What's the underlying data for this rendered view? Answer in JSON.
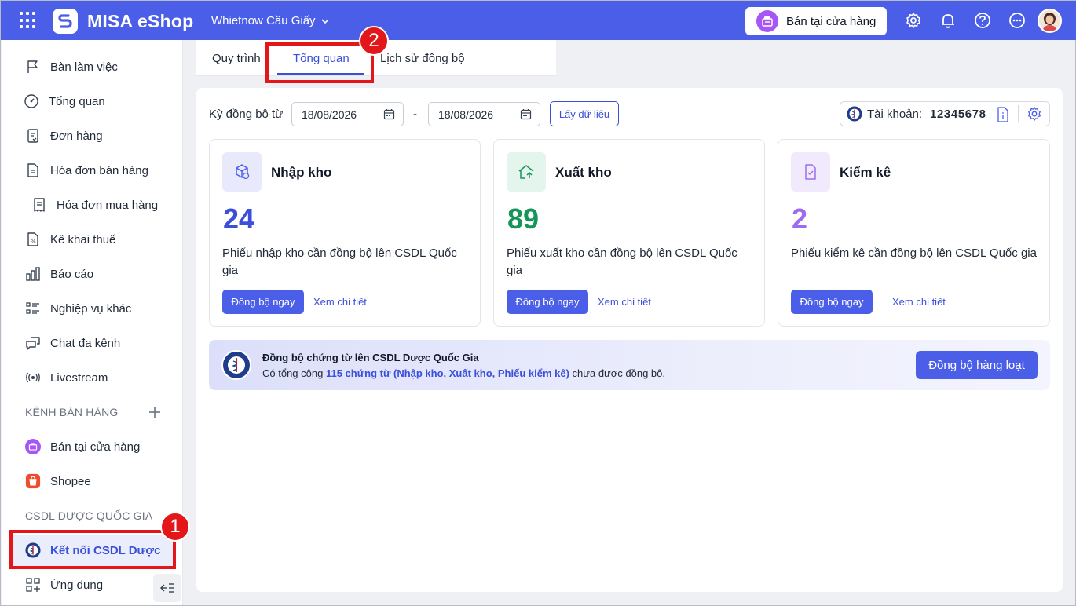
{
  "header": {
    "app_title": "MISA eShop",
    "store_name": "Whietnow Cầu Giấy",
    "sell_button": "Bán tại cửa hàng",
    "brand_color": "#4b5ee8"
  },
  "sidebar": {
    "items": [
      {
        "label": "Bàn làm việc",
        "icon": "flag-icon"
      },
      {
        "label": "Tổng quan",
        "icon": "dashboard-icon"
      },
      {
        "label": "Đơn hàng",
        "icon": "order-icon"
      },
      {
        "label": "Hóa đơn bán hàng",
        "icon": "invoice-icon"
      },
      {
        "label": "Hóa đơn mua hàng",
        "icon": "receipt-icon"
      },
      {
        "label": "Kê khai thuế",
        "icon": "tax-icon"
      },
      {
        "label": "Báo cáo",
        "icon": "chart-icon"
      },
      {
        "label": "Nghiệp vụ khác",
        "icon": "list-icon"
      },
      {
        "label": "Chat đa kênh",
        "icon": "chat-icon"
      },
      {
        "label": "Livestream",
        "icon": "broadcast-icon"
      }
    ],
    "section_sales": "KÊNH BÁN HÀNG",
    "sales_items": [
      {
        "label": "Bán tại cửa hàng"
      },
      {
        "label": "Shopee"
      }
    ],
    "section_pharma": "CSDL DƯỢC QUỐC GIA",
    "pharma_item": "Kết nối CSDL Dược",
    "apps_item": "Ứng dụng"
  },
  "annotations": {
    "badge_1": "1",
    "badge_2": "2"
  },
  "tabs": [
    {
      "label": "Quy trình"
    },
    {
      "label": "Tổng quan"
    },
    {
      "label": "Lịch sử đồng bộ"
    }
  ],
  "filter": {
    "label": "Kỳ đồng bộ từ",
    "from_date": "18/08/2026",
    "to_date": "18/08/2026",
    "separator": "-",
    "fetch_button": "Lấy dữ liệu",
    "account_label": "Tài khoản:",
    "account_number": "12345678"
  },
  "cards": [
    {
      "title": "Nhập kho",
      "count": "24",
      "description": "Phiếu nhập kho cần đồng bộ lên CSDL Quốc gia",
      "sync_button": "Đồng bộ ngay",
      "detail_link": "Xem chi tiết",
      "color": "#3b4fd8"
    },
    {
      "title": "Xuất kho",
      "count": "89",
      "description": "Phiếu xuất kho cần đồng bộ lên CSDL Quốc gia",
      "sync_button": "Đồng bộ ngay",
      "detail_link": "Xem chi tiết",
      "color": "#16955a"
    },
    {
      "title": "Kiểm kê",
      "count": "2",
      "description": "Phiếu kiểm kê cần đồng bộ lên CSDL Quốc gia",
      "sync_button": "Đồng bộ ngay",
      "detail_link": "Xem chi tiết",
      "color": "#9b6cf0"
    }
  ],
  "banner": {
    "title": "Đồng bộ chứng từ lên CSDL Dược Quốc Gia",
    "text_before": "Có tổng cộng",
    "text_highlight": "115 chứng từ (Nhập kho, Xuất kho, Phiếu kiểm kê)",
    "text_after": "chưa được đồng bộ.",
    "bulk_button": "Đồng bộ hàng loạt"
  }
}
